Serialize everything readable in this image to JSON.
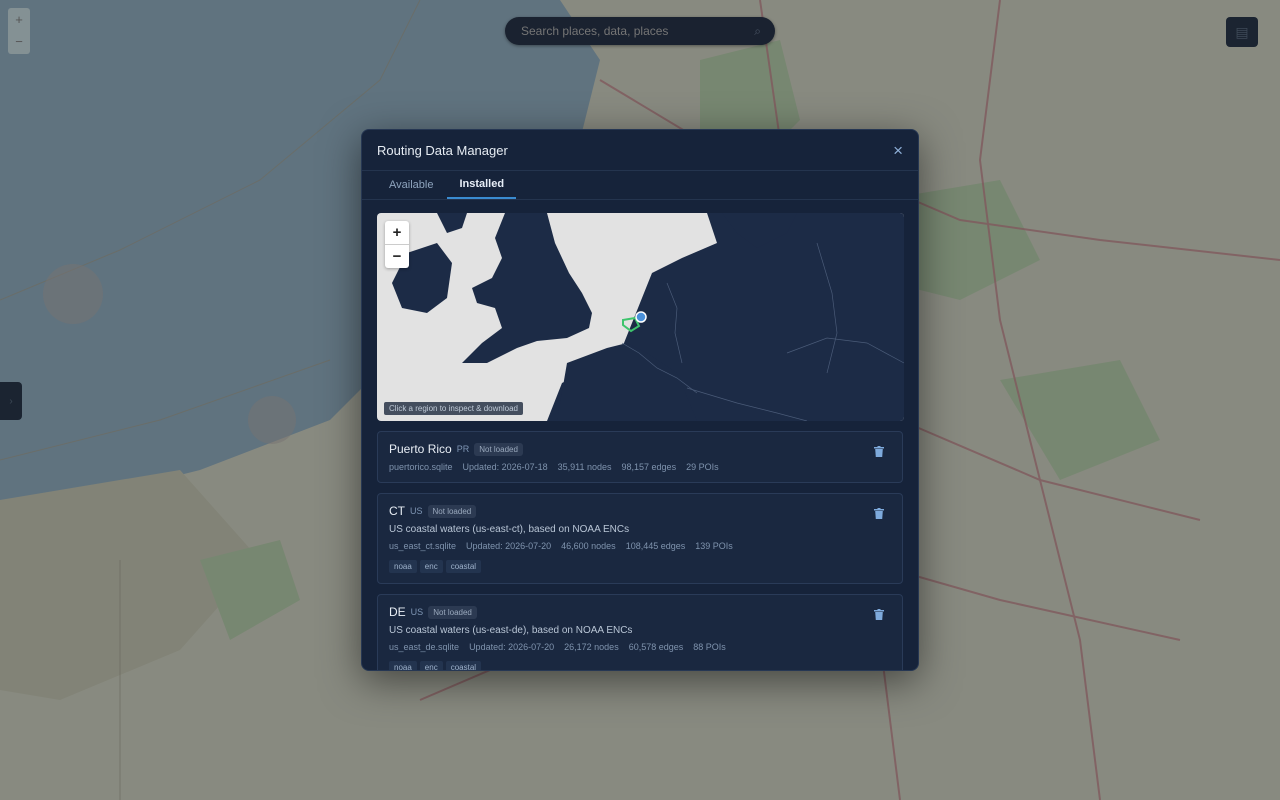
{
  "search": {
    "placeholder": "Search places, data, places"
  },
  "modal": {
    "title": "Routing Data Manager",
    "close_icon": "×",
    "tabs": [
      {
        "label": "Available",
        "active": false
      },
      {
        "label": "Installed",
        "active": true
      }
    ],
    "map": {
      "zoom_in": "+",
      "zoom_out": "−",
      "hint": "Click a region to inspect & download"
    },
    "datasets": [
      {
        "name": "Puerto Rico",
        "code": "PR",
        "status": "Not loaded",
        "description": "",
        "meta": [
          "puertorico.sqlite",
          "Updated: 2026-07-18",
          "35,911 nodes",
          "98,157 edges",
          "29 POIs"
        ],
        "tags": []
      },
      {
        "name": "CT",
        "code": "US",
        "status": "Not loaded",
        "description": "US coastal waters (us-east-ct), based on NOAA ENCs",
        "meta": [
          "us_east_ct.sqlite",
          "Updated: 2026-07-20",
          "46,600 nodes",
          "108,445 edges",
          "139 POIs"
        ],
        "tags": [
          "noaa",
          "enc",
          "coastal"
        ]
      },
      {
        "name": "DE",
        "code": "US",
        "status": "Not loaded",
        "description": "US coastal waters (us-east-de), based on NOAA ENCs",
        "meta": [
          "us_east_de.sqlite",
          "Updated: 2026-07-20",
          "26,172 nodes",
          "60,578 edges",
          "88 POIs"
        ],
        "tags": [
          "noaa",
          "enc",
          "coastal"
        ]
      }
    ]
  },
  "colors": {
    "accent": "#3a8bd0",
    "region_outline": "#3ec46d",
    "marker": "#4a90d9"
  }
}
